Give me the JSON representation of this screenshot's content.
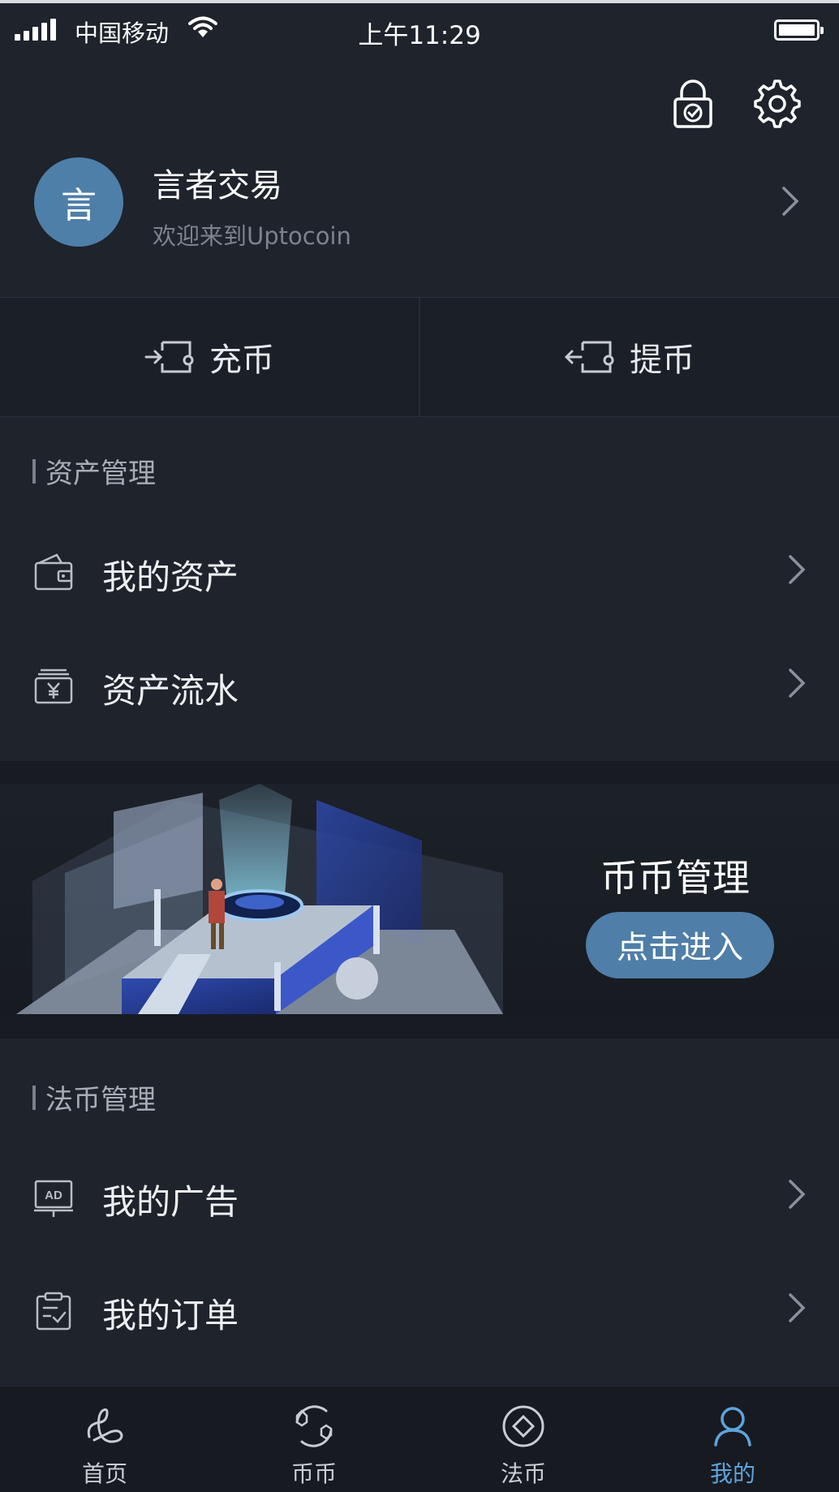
{
  "status_bar": {
    "carrier": "中国移动",
    "time": "上午11:29"
  },
  "header": {
    "avatar_text": "言",
    "user_name": "言者交易",
    "welcome": "欢迎来到Uptocoin",
    "icons": [
      "lock-icon",
      "gear-icon"
    ]
  },
  "quick_actions": {
    "deposit_label": "充币",
    "withdraw_label": "提币"
  },
  "asset_section": {
    "title": "资产管理",
    "items": [
      {
        "label": "我的资产",
        "icon": "wallet-icon"
      },
      {
        "label": "资产流水",
        "icon": "yuan-ledger-icon"
      }
    ]
  },
  "banner": {
    "title": "币币管理",
    "button_label": "点击进入"
  },
  "fiat_section": {
    "title": "法币管理",
    "items": [
      {
        "label": "我的广告",
        "icon": "ad-icon"
      },
      {
        "label": "我的订单",
        "icon": "order-icon"
      }
    ]
  },
  "tabbar": {
    "active_color": "#5ea4dc",
    "tabs": [
      {
        "label": "首页",
        "icon": "home-icon"
      },
      {
        "label": "币币",
        "icon": "coin-exchange-icon"
      },
      {
        "label": "法币",
        "icon": "fiat-icon"
      },
      {
        "label": "我的",
        "icon": "profile-icon",
        "active": true
      }
    ]
  }
}
